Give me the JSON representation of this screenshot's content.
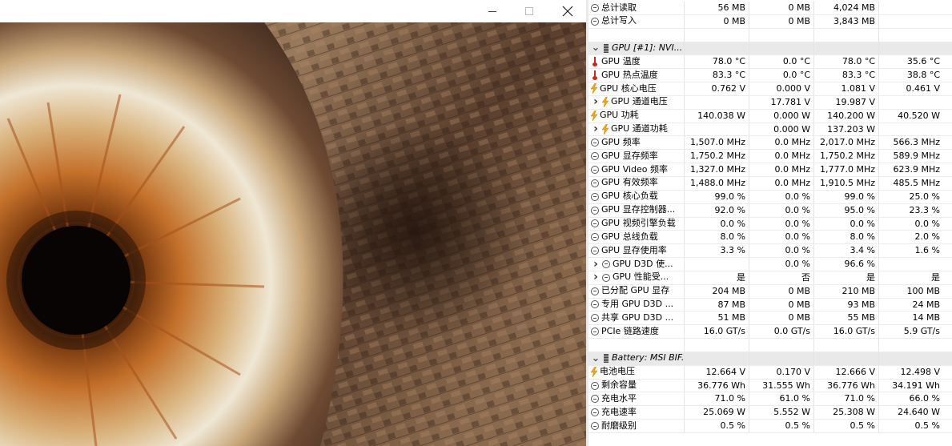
{
  "window": {
    "minimize_icon": "minimize-icon",
    "maximize_icon": "maximize-icon",
    "close_icon": "close-icon"
  },
  "sensors": {
    "rows": [
      {
        "kind": "item",
        "icon": "clock-icon",
        "name": "总计读取",
        "v": [
          "56 MB",
          "0 MB",
          "4,024 MB",
          ""
        ]
      },
      {
        "kind": "item",
        "icon": "clock-icon",
        "name": "总计写入",
        "v": [
          "0 MB",
          "0 MB",
          "3,843 MB",
          ""
        ]
      },
      {
        "kind": "spacer"
      },
      {
        "kind": "group",
        "icon": "chip-icon",
        "name": "GPU [#1]: NVI...",
        "expander": "chevron-down-icon"
      },
      {
        "kind": "item",
        "icon": "thermometer-icon",
        "name": "GPU 温度",
        "v": [
          "78.0 °C",
          "0.0 °C",
          "78.0 °C",
          "35.6 °C"
        ]
      },
      {
        "kind": "item",
        "icon": "thermometer-icon",
        "name": "GPU 热点温度",
        "v": [
          "83.3 °C",
          "0.0 °C",
          "83.3 °C",
          "38.8 °C"
        ]
      },
      {
        "kind": "item",
        "icon": "bolt-icon",
        "name": "GPU 核心电压",
        "v": [
          "0.762 V",
          "0.000 V",
          "1.081 V",
          "0.461 V"
        ]
      },
      {
        "kind": "item",
        "icon": "bolt-icon",
        "name": "GPU 通道电压",
        "expander": "chevron-right-icon",
        "v": [
          "",
          "17.781 V",
          "19.987 V",
          ""
        ]
      },
      {
        "kind": "item",
        "icon": "bolt-icon",
        "name": "GPU 功耗",
        "v": [
          "140.038 W",
          "0.000 W",
          "140.200 W",
          "40.520 W"
        ]
      },
      {
        "kind": "item",
        "icon": "bolt-icon",
        "name": "GPU 通道功耗",
        "expander": "chevron-right-icon",
        "v": [
          "",
          "0.000 W",
          "137.203 W",
          ""
        ]
      },
      {
        "kind": "item",
        "icon": "clock-icon",
        "name": "GPU 频率",
        "v": [
          "1,507.0 MHz",
          "0.0 MHz",
          "2,017.0 MHz",
          "566.3 MHz"
        ]
      },
      {
        "kind": "item",
        "icon": "clock-icon",
        "name": "GPU 显存频率",
        "v": [
          "1,750.2 MHz",
          "0.0 MHz",
          "1,750.2 MHz",
          "589.9 MHz"
        ]
      },
      {
        "kind": "item",
        "icon": "clock-icon",
        "name": "GPU Video 频率",
        "v": [
          "1,327.0 MHz",
          "0.0 MHz",
          "1,777.0 MHz",
          "623.9 MHz"
        ]
      },
      {
        "kind": "item",
        "icon": "clock-icon",
        "name": "GPU 有效频率",
        "v": [
          "1,488.0 MHz",
          "0.0 MHz",
          "1,910.5 MHz",
          "485.5 MHz"
        ]
      },
      {
        "kind": "item",
        "icon": "clock-icon",
        "name": "GPU 核心负载",
        "v": [
          "99.0 %",
          "0.0 %",
          "99.0 %",
          "25.0 %"
        ]
      },
      {
        "kind": "item",
        "icon": "clock-icon",
        "name": "GPU 显存控制器...",
        "v": [
          "92.0 %",
          "0.0 %",
          "95.0 %",
          "23.3 %"
        ]
      },
      {
        "kind": "item",
        "icon": "clock-icon",
        "name": "GPU 视频引擎负载",
        "v": [
          "0.0 %",
          "0.0 %",
          "0.0 %",
          "0.0 %"
        ]
      },
      {
        "kind": "item",
        "icon": "clock-icon",
        "name": "GPU 总线负载",
        "v": [
          "8.0 %",
          "0.0 %",
          "8.0 %",
          "2.0 %"
        ]
      },
      {
        "kind": "item",
        "icon": "clock-icon",
        "name": "GPU 显存使用率",
        "v": [
          "3.3 %",
          "0.0 %",
          "3.4 %",
          "1.6 %"
        ]
      },
      {
        "kind": "item",
        "icon": "clock-icon",
        "name": "GPU D3D 使...",
        "expander": "chevron-right-icon",
        "v": [
          "",
          "0.0 %",
          "96.6 %",
          ""
        ]
      },
      {
        "kind": "item",
        "icon": "clock-icon",
        "name": "GPU 性能受...",
        "expander": "chevron-right-icon",
        "v": [
          "是",
          "否",
          "是",
          "是"
        ]
      },
      {
        "kind": "item",
        "icon": "clock-icon",
        "name": "已分配 GPU 显存",
        "v": [
          "204 MB",
          "0 MB",
          "210 MB",
          "100 MB"
        ]
      },
      {
        "kind": "item",
        "icon": "clock-icon",
        "name": "专用 GPU D3D ...",
        "v": [
          "87 MB",
          "0 MB",
          "93 MB",
          "24 MB"
        ]
      },
      {
        "kind": "item",
        "icon": "clock-icon",
        "name": "共享 GPU D3D ...",
        "v": [
          "51 MB",
          "0 MB",
          "55 MB",
          "14 MB"
        ]
      },
      {
        "kind": "item",
        "icon": "clock-icon",
        "name": "PCIe 链路速度",
        "v": [
          "16.0 GT/s",
          "0.0 GT/s",
          "16.0 GT/s",
          "5.9 GT/s"
        ]
      },
      {
        "kind": "spacer"
      },
      {
        "kind": "group",
        "icon": "chip-icon",
        "name": "Battery: MSI BIF...",
        "expander": "chevron-down-icon"
      },
      {
        "kind": "item",
        "icon": "bolt-icon",
        "name": "电池电压",
        "v": [
          "12.664 V",
          "0.170 V",
          "12.666 V",
          "12.498 V"
        ]
      },
      {
        "kind": "item",
        "icon": "clock-icon",
        "name": "剩余容量",
        "v": [
          "36.776 Wh",
          "31.555 Wh",
          "36.776 Wh",
          "34.191 Wh"
        ]
      },
      {
        "kind": "item",
        "icon": "clock-icon",
        "name": "充电水平",
        "v": [
          "71.0 %",
          "61.0 %",
          "71.0 %",
          "66.0 %"
        ]
      },
      {
        "kind": "item",
        "icon": "clock-icon",
        "name": "充电速率",
        "v": [
          "25.069 W",
          "5.552 W",
          "25.308 W",
          "24.640 W"
        ]
      },
      {
        "kind": "item",
        "icon": "clock-icon",
        "name": "耐磨级别",
        "v": [
          "0.5 %",
          "0.5 %",
          "0.5 %",
          "0.5 %"
        ]
      }
    ]
  }
}
